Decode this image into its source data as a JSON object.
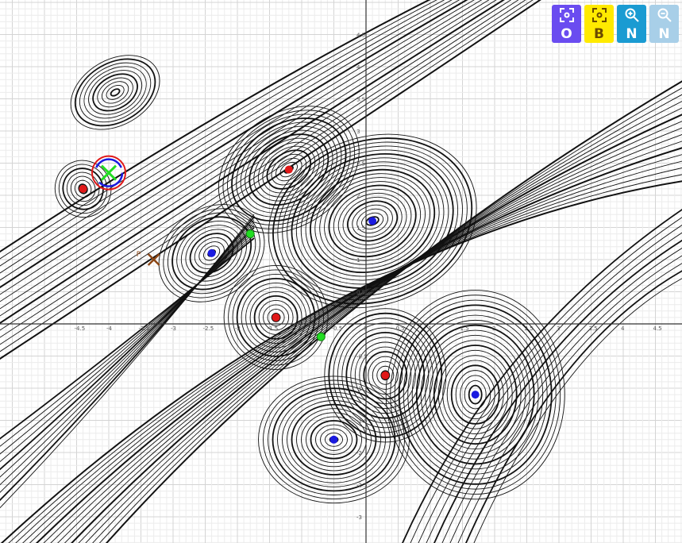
{
  "axes": {
    "x_ticks": [
      "-4.5",
      "-4",
      "-3.5",
      "-3",
      "-2.5",
      "-2",
      "-1.5",
      "-1",
      "-0.5",
      "0",
      "0.5",
      "1",
      "1.5",
      "2",
      "2.5",
      "3",
      "3.5",
      "4",
      "4.5"
    ],
    "y_ticks": [
      "4.5",
      "4",
      "3.5",
      "3",
      "2.5",
      "2",
      "1.5",
      "1",
      "0.5",
      "-0.5",
      "-1",
      "-1.5",
      "-2",
      "-2.5",
      "-3"
    ],
    "x_range": [
      -5.7,
      4.9
    ],
    "y_range": [
      -3.4,
      5
    ]
  },
  "colors": {
    "curve": "#111111",
    "grid_minor": "#ececec",
    "grid_major": "#d4d4d4",
    "axis": "#333333",
    "point_red": "#e01818",
    "point_blue": "#1a1ae0",
    "point_green": "#22dd22",
    "point_brown": "#8b4513"
  },
  "points": {
    "red": [
      [
        -4.4,
        2.1
      ],
      [
        -1.2,
        2.4
      ],
      [
        -1.4,
        0.1
      ],
      [
        0.3,
        -0.8
      ]
    ],
    "blue": [
      [
        0.1,
        1.6
      ],
      [
        -2.4,
        1.1
      ],
      [
        -0.5,
        -1.8
      ],
      [
        1.7,
        -1.1
      ]
    ],
    "green": [
      [
        -1.8,
        1.4
      ],
      [
        -0.7,
        -0.2
      ]
    ]
  },
  "markers": {
    "p_label": "P",
    "p_point": [
      -3.3,
      1.0
    ],
    "x_label": "X",
    "x_point": [
      -4.0,
      2.35
    ]
  },
  "toolbar": [
    {
      "letter": "O",
      "icon": "frame-center-icon",
      "bg": "#6a4cf0",
      "fg": "#ffffff"
    },
    {
      "letter": "B",
      "icon": "frame-center-icon",
      "bg": "#ffea00",
      "fg": "#6a4a00"
    },
    {
      "letter": "N",
      "icon": "zoom-in-icon",
      "bg": "#1a9bd2",
      "fg": "#ffffff"
    },
    {
      "letter": "N",
      "icon": "zoom-out-icon",
      "bg": "#a8cfe8",
      "fg": "#ffffff"
    }
  ]
}
